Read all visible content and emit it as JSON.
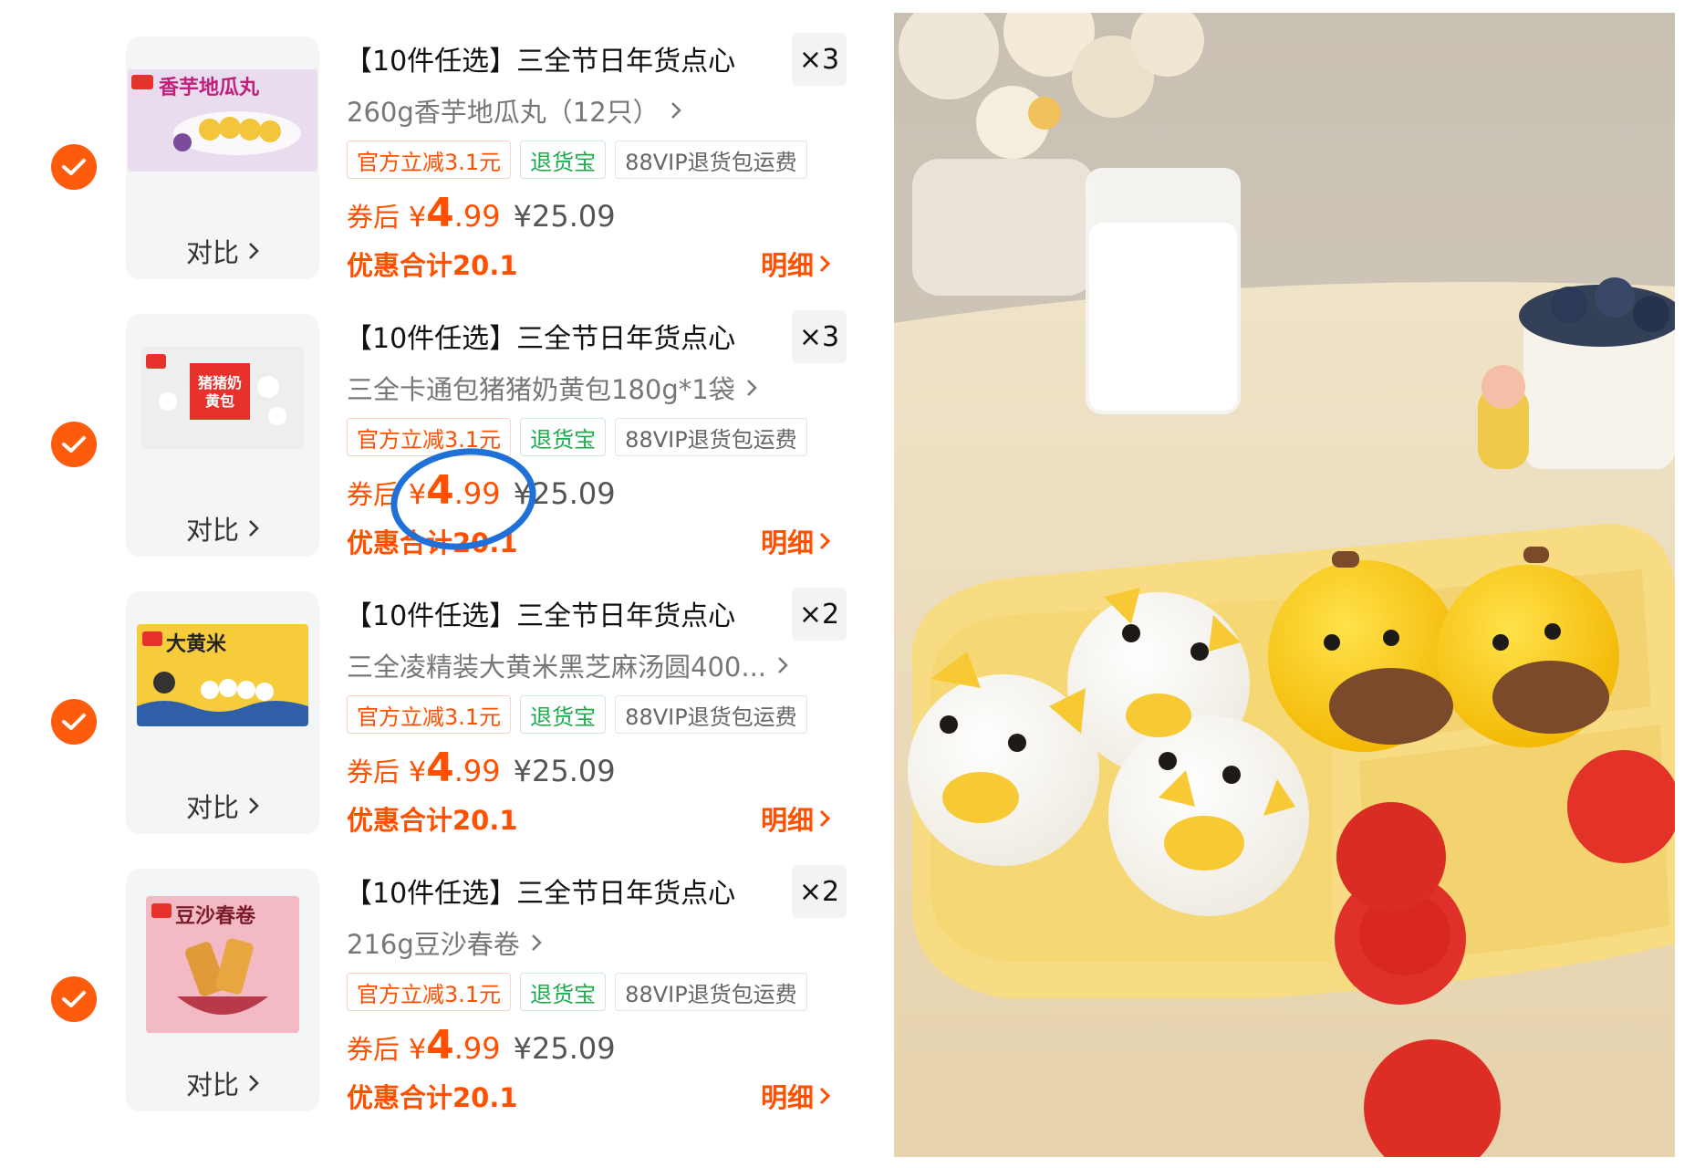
{
  "colors": {
    "accent": "#ff5000",
    "check": "#ff5b0c",
    "green_tag": "#1eaa4a",
    "annotation": "#1f71d8"
  },
  "cart": {
    "items": [
      {
        "thumb_text": "香芋地瓜丸",
        "title": "【10件任选】三全节日年货点心",
        "qty": "×3",
        "spec": "260g香芋地瓜丸（12只）",
        "compare": "对比",
        "tags": [
          "官方立减3.1元",
          "退货宝",
          "88VIP退货包运费"
        ],
        "price_label": "券后",
        "price_yen": "¥",
        "price_int": "4",
        "price_dec": ".99",
        "price_orig": "¥25.09",
        "savings": "优惠合计20.1",
        "detail": "明细"
      },
      {
        "thumb_text": "猪猪奶黄包",
        "title": "【10件任选】三全节日年货点心",
        "qty": "×3",
        "spec": "三全卡通包猪猪奶黄包180g*1袋",
        "compare": "对比",
        "tags": [
          "官方立减3.1元",
          "退货宝",
          "88VIP退货包运费"
        ],
        "price_label": "券后",
        "price_yen": "¥",
        "price_int": "4",
        "price_dec": ".99",
        "price_orig": "¥25.09",
        "savings": "优惠合计20.1",
        "detail": "明细"
      },
      {
        "thumb_text": "大黄米",
        "title": "【10件任选】三全节日年货点心",
        "qty": "×2",
        "spec": "三全凌精装大黄米黑芝麻汤圆400...",
        "compare": "对比",
        "tags": [
          "官方立减3.1元",
          "退货宝",
          "88VIP退货包运费"
        ],
        "price_label": "券后",
        "price_yen": "¥",
        "price_int": "4",
        "price_dec": ".99",
        "price_orig": "¥25.09",
        "savings": "优惠合计20.1",
        "detail": "明细"
      },
      {
        "thumb_text": "豆沙春卷",
        "title": "【10件任选】三全节日年货点心",
        "qty": "×2",
        "spec": "216g豆沙春卷",
        "compare": "对比",
        "tags": [
          "官方立减3.1元",
          "退货宝",
          "88VIP退货包运费"
        ],
        "price_label": "券后",
        "price_yen": "¥",
        "price_int": "4",
        "price_dec": ".99",
        "price_orig": "¥25.09",
        "savings": "优惠合计20.1",
        "detail": "明细"
      }
    ]
  },
  "icons": {
    "check": "check-icon",
    "chevron": "chevron-right-icon"
  },
  "photo": {
    "subject": "pig-and-cow-shaped-steamed-buns-photo"
  }
}
